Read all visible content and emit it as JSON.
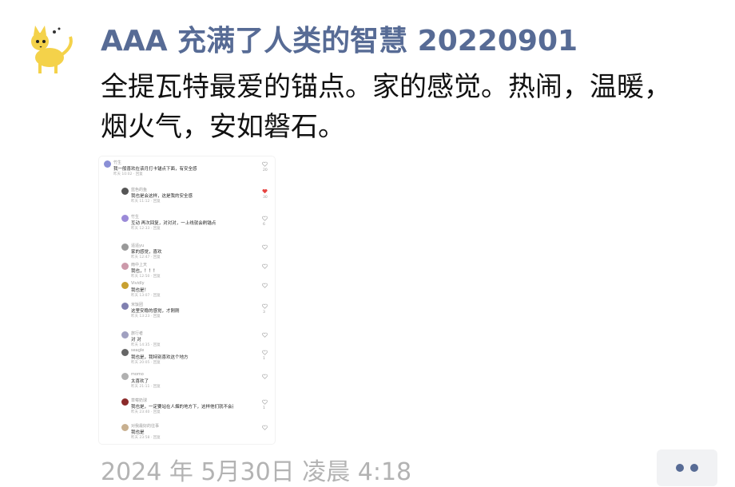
{
  "post": {
    "author": "AAA 充满了人类的智慧 20220901",
    "content": "全提瓦特最爱的锚点。家的感觉。热闹，温暖，烟火气，安如磐石。",
    "timestamp": "2024 年 5月30日 凌晨 4:18"
  },
  "embedded_screenshot": {
    "comments": [
      {
        "name": "竹生",
        "text": "我一般喜欢在该月打卡锚点下面，有安全感",
        "meta": "昨天 10:02 · 回复",
        "count": "20"
      },
      {
        "name": "蓝色的鱼",
        "text": "我也是会这样，这是我的安全感",
        "meta": "昨天 11:12 · 回复",
        "count": "30"
      },
      {
        "name": "竹生",
        "text": "互动 再次回复，对对对，一上线就会刷锚点",
        "meta": "昨天 12:33 · 回复",
        "count": "6"
      },
      {
        "name": "遥遥yu",
        "text": "家的感觉，喜欢",
        "meta": "昨天 12:47 · 回复",
        "count": ""
      },
      {
        "name": "雨中上天",
        "text": "我也，！！！",
        "meta": "昨天 12:50 · 回复",
        "count": ""
      },
      {
        "name": "Vividly",
        "text": "我也是！",
        "meta": "昨天 13:07 · 回复",
        "count": ""
      },
      {
        "name": "米饭团",
        "text": "这里安稳的感觉，才刚刚",
        "meta": "昨天 13:23 · 回复",
        "count": "3"
      },
      {
        "name": "旅行者",
        "text": "对 对",
        "meta": "昨天 14:35 · 回复",
        "count": ""
      },
      {
        "name": "seagle",
        "text": "我也是，我特别喜欢这个地方",
        "meta": "昨天 20:05 · 回复",
        "count": "1"
      },
      {
        "name": "momo",
        "text": "太喜欢了",
        "meta": "昨天 21:11 · 回复",
        "count": ""
      },
      {
        "name": "草莓奶球",
        "text": "我也是，一定要站在人烟的地方下，这样他们就不会孤单",
        "meta": "昨天 23:40 · 回复",
        "count": "1"
      },
      {
        "name": "对我最好的往事",
        "text": "我也是",
        "meta": "昨天 23:58 · 回复",
        "count": ""
      }
    ]
  },
  "colors": {
    "name": "#576b95",
    "text": "#111111",
    "time": "#b3b3b3",
    "heart_active": "#e64340"
  },
  "icons": {
    "avatar": "yellow-cat-avatar",
    "more": "more-dots-icon",
    "heart": "heart-icon"
  }
}
